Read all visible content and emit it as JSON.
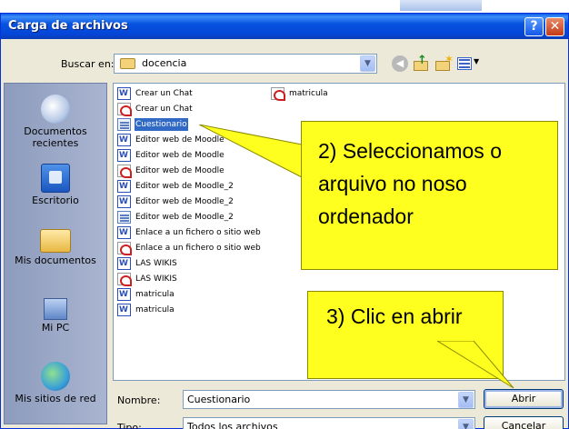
{
  "dialog": {
    "title": "Carga de archivos",
    "help_button": "?",
    "close_button": "✕"
  },
  "lookin": {
    "label": "Buscar en:",
    "value": "docencia"
  },
  "places": [
    {
      "label": "Documentos recientes",
      "icon": "recent-documents-icon"
    },
    {
      "label": "Escritorio",
      "icon": "desktop-icon"
    },
    {
      "label": "Mis documentos",
      "icon": "my-documents-icon"
    },
    {
      "label": "Mi PC",
      "icon": "my-computer-icon"
    },
    {
      "label": "Mis sitios de red",
      "icon": "network-places-icon"
    }
  ],
  "files": [
    {
      "name": "Crear un Chat",
      "type": "word"
    },
    {
      "name": "Crear un Chat",
      "type": "pdf"
    },
    {
      "name": "Cuestionario",
      "type": "xml",
      "selected": true
    },
    {
      "name": "Editor web de Moodle",
      "type": "word"
    },
    {
      "name": "Editor web de Moodle",
      "type": "word"
    },
    {
      "name": "Editor web de Moodle",
      "type": "pdf"
    },
    {
      "name": "Editor web de Moodle_2",
      "type": "word"
    },
    {
      "name": "Editor web de Moodle_2",
      "type": "word"
    },
    {
      "name": "Editor web de Moodle_2",
      "type": "xml"
    },
    {
      "name": "Enlace a un fichero o sitio web",
      "type": "word"
    },
    {
      "name": "Enlace a un fichero o sitio web",
      "type": "pdf"
    },
    {
      "name": "LAS WIKIS",
      "type": "word"
    },
    {
      "name": "LAS WIKIS",
      "type": "pdf"
    },
    {
      "name": "matricula",
      "type": "word"
    },
    {
      "name": "matricula",
      "type": "word"
    },
    {
      "name": "matricula",
      "type": "pdf"
    }
  ],
  "callouts": {
    "select": "2) Seleccionamos o arquivo no noso ordenador",
    "open": "3) Clic en abrir"
  },
  "form": {
    "name_label": "Nombre:",
    "name_value": "Cuestionario",
    "type_label": "Tipo:",
    "type_value": "Todos los archivos",
    "open_button": "Abrir",
    "cancel_button": "Cancelar"
  },
  "colors": {
    "title_bar": "#0753e0",
    "selection": "#316ac5",
    "callout": "#ffff1f"
  }
}
